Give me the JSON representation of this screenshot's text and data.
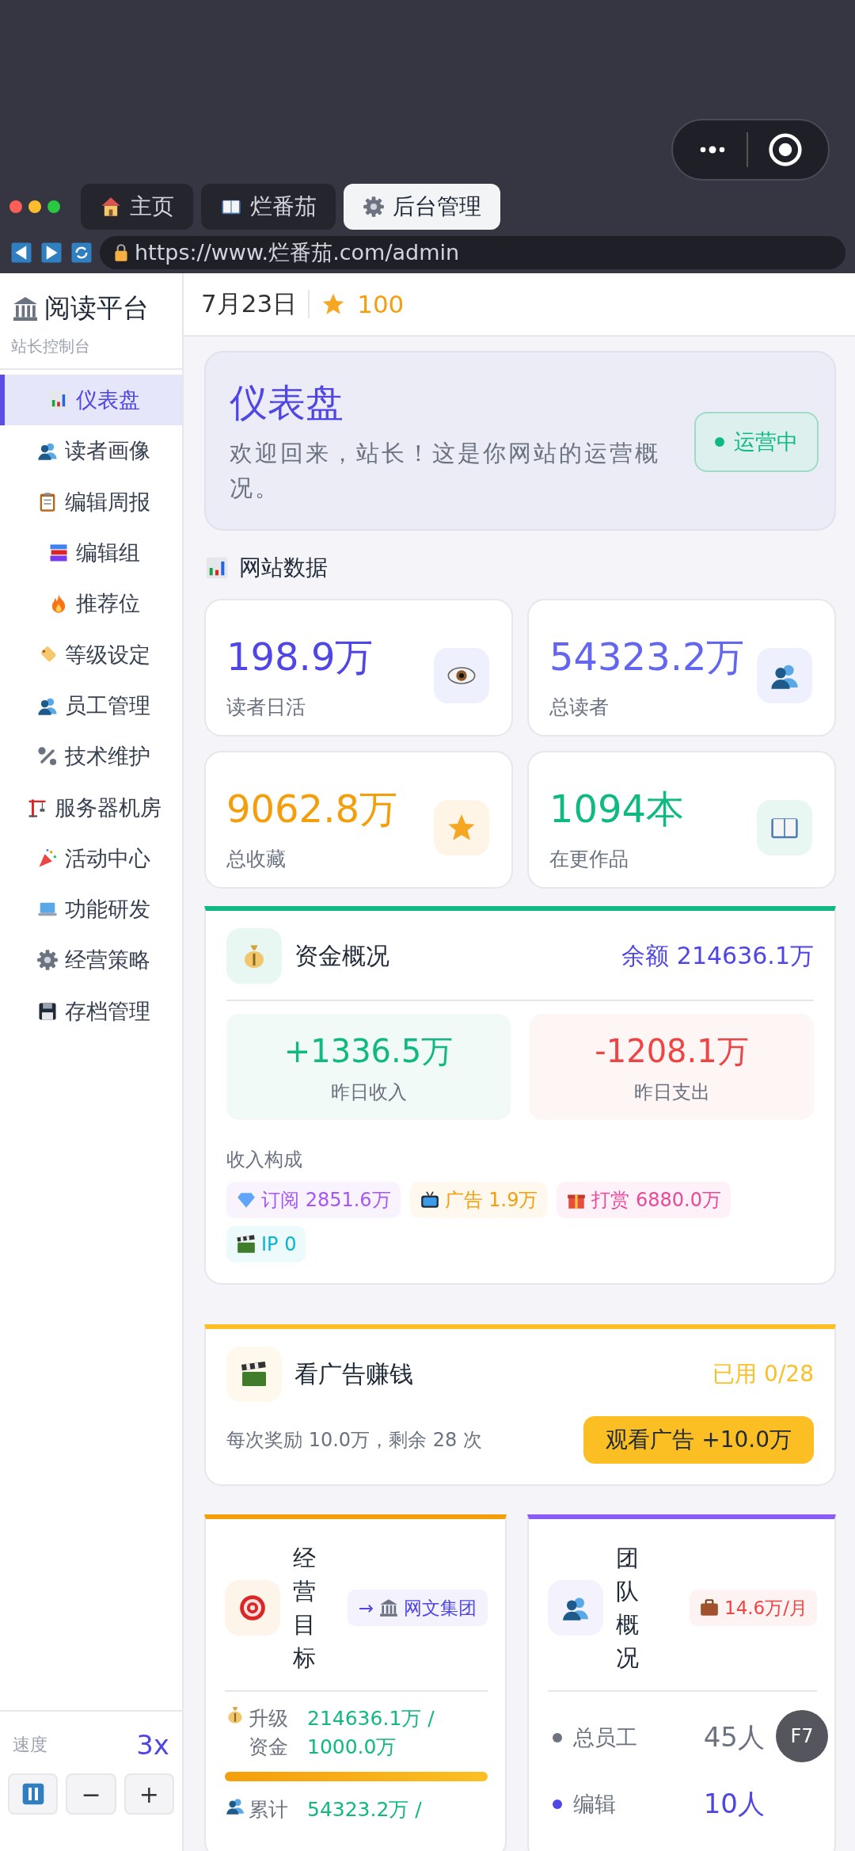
{
  "browser": {
    "tabs": [
      {
        "label": "主页",
        "selected": false
      },
      {
        "label": "烂番茄",
        "selected": false
      },
      {
        "label": "后台管理",
        "selected": true
      }
    ],
    "url": "https://www.烂番茄.com/admin"
  },
  "sidebar": {
    "title": "阅读平台",
    "subtitle": "站长控制台",
    "items": [
      {
        "label": "仪表盘",
        "selected": true
      },
      {
        "label": "读者画像",
        "selected": false
      },
      {
        "label": "编辑周报",
        "selected": false
      },
      {
        "label": "编辑组",
        "selected": false
      },
      {
        "label": "推荐位",
        "selected": false
      },
      {
        "label": "等级设定",
        "selected": false
      },
      {
        "label": "员工管理",
        "selected": false
      },
      {
        "label": "技术维护",
        "selected": false
      },
      {
        "label": "服务器机房",
        "selected": false
      },
      {
        "label": "活动中心",
        "selected": false
      },
      {
        "label": "功能研发",
        "selected": false
      },
      {
        "label": "经营策略",
        "selected": false
      },
      {
        "label": "存档管理",
        "selected": false
      }
    ],
    "speed": {
      "label": "速度",
      "value": "3x"
    },
    "speed_buttons": [
      "−",
      "+"
    ]
  },
  "header": {
    "date": "7月23日",
    "points": "100"
  },
  "welcome": {
    "title": "仪表盘",
    "message": "欢迎回来，站长！这是你网站的运营概况。",
    "status": "运营中"
  },
  "site_data": {
    "heading": "网站数据",
    "stats": [
      {
        "value": "198.9万",
        "label": "读者日活",
        "color": "#4f46e5"
      },
      {
        "value": "54323.2万",
        "label": "总读者",
        "color": "#6366f1"
      },
      {
        "value": "9062.8万",
        "label": "总收藏",
        "color": "#f59e0b"
      },
      {
        "value": "1094本",
        "label": "在更作品",
        "color": "#10b981"
      }
    ]
  },
  "funds": {
    "title": "资金概况",
    "balance": "余额 214636.1万",
    "income": {
      "value": "+1336.5万",
      "label": "昨日收入"
    },
    "expense": {
      "value": "-1208.1万",
      "label": "昨日支出"
    },
    "breakdown_label": "收入构成",
    "breakdown": [
      {
        "label": "订阅 2851.6万",
        "color": "#a855f7"
      },
      {
        "label": "广告 1.9万",
        "color": "#f59e0b"
      },
      {
        "label": "打赏 6880.0万",
        "color": "#ec4899"
      },
      {
        "label": "IP 0",
        "color": "#06b6d4"
      }
    ]
  },
  "ad": {
    "title": "看广告赚钱",
    "used": "已用 0/28",
    "note": "每次奖励 10.0万，剩余 28 次",
    "button": "观看广告 +10.0万"
  },
  "goals": {
    "title": "经营目标",
    "link_arrow": "→",
    "link": "网文集团",
    "rows": [
      {
        "label": "升级资金",
        "value": "214636.1万 / 1000.0万",
        "level": 1
      },
      {
        "label": "累计",
        "value": "54323.2万 /"
      }
    ]
  },
  "team": {
    "title": "团队概况",
    "salary": "14.6万/月",
    "rows": [
      {
        "label": "总员工",
        "value": "45人",
        "color": "#6b7280"
      },
      {
        "label": "编辑",
        "value": "10人",
        "color": "#4f46e5"
      }
    ]
  },
  "floating_badge": "F7"
}
